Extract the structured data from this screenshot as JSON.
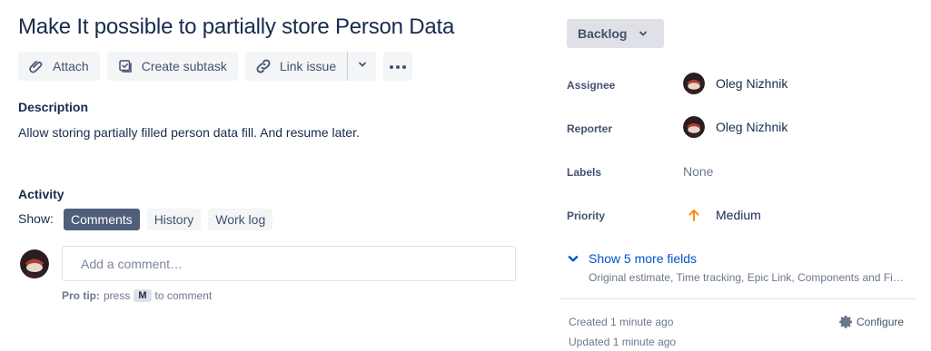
{
  "issue": {
    "title": "Make It possible to partially store Person Data"
  },
  "toolbar": {
    "attach": "Attach",
    "create_subtask": "Create subtask",
    "link_issue": "Link issue"
  },
  "description": {
    "heading": "Description",
    "text": "Allow storing partially filled person data fill. And resume later."
  },
  "activity": {
    "heading": "Activity",
    "show_label": "Show:",
    "filters": [
      "Comments",
      "History",
      "Work log"
    ],
    "active_filter": "Comments",
    "comment_placeholder": "Add a comment…",
    "protip_bold": "Pro tip:",
    "protip_pre": "press",
    "protip_key": "M",
    "protip_post": "to comment"
  },
  "sidebar": {
    "status": "Backlog",
    "fields": {
      "assignee": {
        "label": "Assignee",
        "value": "Oleg Nizhnik"
      },
      "reporter": {
        "label": "Reporter",
        "value": "Oleg Nizhnik"
      },
      "labels": {
        "label": "Labels",
        "value": "None"
      },
      "priority": {
        "label": "Priority",
        "value": "Medium",
        "icon": "arrow-up-icon",
        "color": "#ff8b00"
      }
    },
    "show_more": "Show 5 more fields",
    "show_more_sub": "Original estimate, Time tracking, Epic Link, Components and Fix versions",
    "created": "Created 1 minute ago",
    "updated": "Updated 1 minute ago",
    "configure": "Configure"
  },
  "colors": {
    "link": "#0052cc",
    "active_filter_bg": "#505f79",
    "status_bg": "#dfe1e6"
  }
}
